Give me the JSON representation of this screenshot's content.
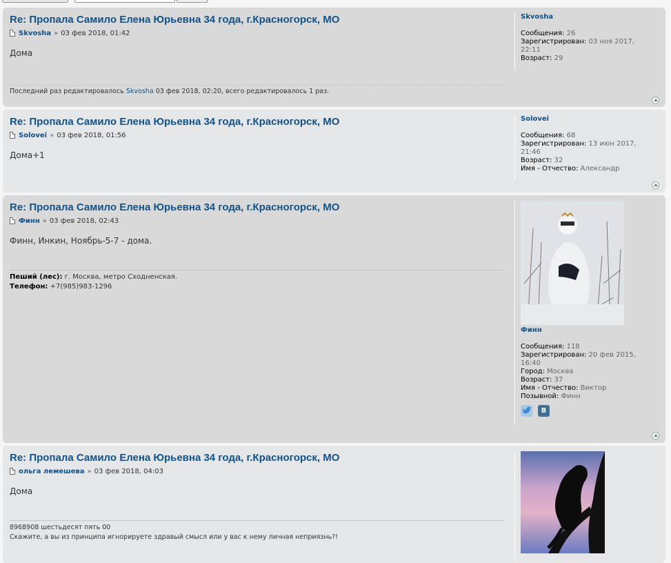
{
  "posts": [
    {
      "title": "Re: Пропала Самило Елена Юрьевна 34 года, г.Красногорск, МО",
      "author": "Skvosha",
      "date": "03 фев 2018, 01:42",
      "text": "Дома",
      "edit_notice": {
        "prefix": "Последний раз редактировалось",
        "user": "Skvosha",
        "suffix": "03 фев 2018, 02:20, всего редактировалось 1 раз."
      },
      "profile": {
        "name": "Skvosha",
        "rows": [
          {
            "label": "Сообщения:",
            "value": "26"
          },
          {
            "label": "Зарегистрирован:",
            "value": "03 ноя 2017, 22:11"
          },
          {
            "label": "Возраст:",
            "value": "29"
          }
        ]
      }
    },
    {
      "title": "Re: Пропала Самило Елена Юрьевна 34 года, г.Красногорск, МО",
      "author": "Solovei",
      "date": "03 фев 2018, 01:56",
      "text": "Дома+1",
      "profile": {
        "name": "Solovei",
        "rows": [
          {
            "label": "Сообщения:",
            "value": "68"
          },
          {
            "label": "Зарегистрирован:",
            "value": "13 июн 2017,"
          },
          {
            "label": "",
            "value": "21:46"
          },
          {
            "label": "Возраст:",
            "value": "32"
          },
          {
            "label": "Имя - Отчество:",
            "value": "Александр"
          }
        ]
      }
    },
    {
      "title": "Re: Пропала Самило Елена Юрьевна 34 года, г.Красногорск, МО",
      "author": "Финн",
      "date": "03 фев 2018, 02:43",
      "text": "Финн, Инкин, Ноябрь-5-7 - дома.",
      "signature": [
        {
          "label": "Пеший (лес):",
          "value": "г. Москва, метро Сходненская."
        },
        {
          "label": "Телефон:",
          "value": "+7(985)983-1296"
        }
      ],
      "profile": {
        "name": "Финн",
        "rows": [
          {
            "label": "Сообщения:",
            "value": "118"
          },
          {
            "label": "Зарегистрирован:",
            "value": "20 фев 2015,"
          },
          {
            "label": "",
            "value": "16:40"
          },
          {
            "label": "Город:",
            "value": "Москва"
          },
          {
            "label": "Возраст:",
            "value": "37"
          },
          {
            "label": "Имя - Отчество:",
            "value": "Виктор"
          },
          {
            "label": "Позывной:",
            "value": "Финн"
          }
        ],
        "social": [
          "twitter-icon",
          "vk-icon"
        ],
        "vk_letter": "B"
      }
    },
    {
      "title": "Re: Пропала Самило Елена Юрьевна 34 года, г.Красногорск, МО",
      "author": "ольга лемешева",
      "date": "03 фев 2018, 04:03",
      "text": "Дома",
      "signature_lines": [
        "8968908 шестьдесят пять 00",
        "Скажите, а вы из принципа игнорируете здравый смысл или у вас к нему личная неприязнь?!"
      ]
    }
  ],
  "separator": "»",
  "colors": {
    "link": "#105289",
    "post_dark": "#d9d9d9",
    "post_light": "#e4e6e8"
  }
}
